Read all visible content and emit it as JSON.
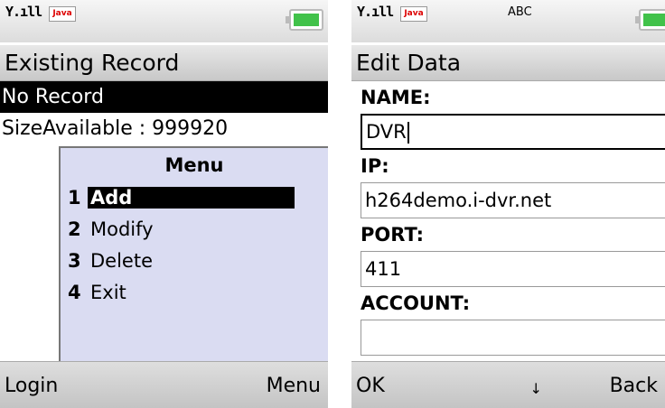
{
  "phone1": {
    "status": {
      "signal": "Y.ıll",
      "java_badge": "Java"
    },
    "title": "Existing Record",
    "rows": [
      {
        "text": "No Record",
        "selected": true
      },
      {
        "text": "SizeAvailable : 999920",
        "selected": false
      }
    ],
    "menu": {
      "title": "Menu",
      "items": [
        {
          "num": "1",
          "label": "Add",
          "selected": true
        },
        {
          "num": "2",
          "label": "Modify",
          "selected": false
        },
        {
          "num": "3",
          "label": "Delete",
          "selected": false
        },
        {
          "num": "4",
          "label": "Exit",
          "selected": false
        }
      ]
    },
    "softkeys": {
      "left": "Login",
      "right": "Menu"
    }
  },
  "phone2": {
    "status": {
      "signal": "Y.ıll",
      "java_badge": "Java",
      "input_mode": "ABC"
    },
    "title": "Edit Data",
    "fields": [
      {
        "label": "NAME:",
        "value": "DVR"
      },
      {
        "label": "IP:",
        "value": "h264demo.i-dvr.net"
      },
      {
        "label": "PORT:",
        "value": "411"
      },
      {
        "label": "ACCOUNT:",
        "value": ""
      }
    ],
    "softkeys": {
      "left": "OK",
      "center": "↓",
      "right": "Back"
    }
  },
  "colors": {
    "battery": "#41c24a",
    "menu_bg": "#dadcf2",
    "highlight": "#000000",
    "java_badge_text": "#dd0000"
  },
  "icons": [
    "signal-icon",
    "java-icon",
    "battery-icon",
    "down-arrow-icon"
  ]
}
